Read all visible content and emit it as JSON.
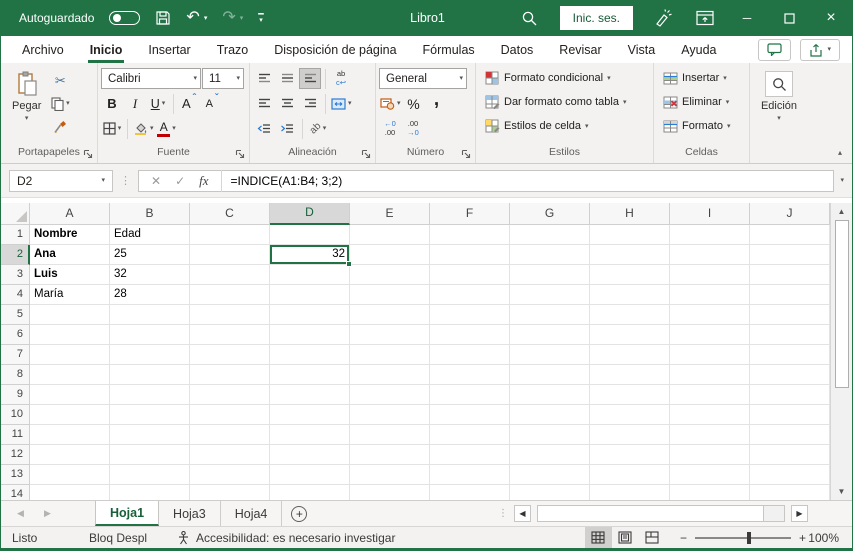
{
  "window": {
    "autosave_label": "Autoguardado",
    "title": "Libro1",
    "signin_label": "Inic. ses."
  },
  "tabs": {
    "active": "Inicio",
    "items": [
      {
        "label": "Archivo"
      },
      {
        "label": "Inicio"
      },
      {
        "label": "Insertar"
      },
      {
        "label": "Trazo"
      },
      {
        "label": "Disposición de página"
      },
      {
        "label": "Fórmulas"
      },
      {
        "label": "Datos"
      },
      {
        "label": "Revisar"
      },
      {
        "label": "Vista"
      },
      {
        "label": "Ayuda"
      }
    ]
  },
  "ribbon": {
    "paste_label": "Pegar",
    "clipboard_group": "Portapapeles",
    "font_group": "Fuente",
    "font_name": "Calibri",
    "font_size": "11",
    "alignment_group": "Alineación",
    "number_group": "Número",
    "number_format": "General",
    "styles_group": "Estilos",
    "styles_buttons": [
      "Formato condicional",
      "Dar formato como tabla",
      "Estilos de celda"
    ],
    "cells_group": "Celdas",
    "cells_buttons": [
      "Insertar",
      "Eliminar",
      "Formato"
    ],
    "editing_group": "Edición"
  },
  "formula_bar": {
    "name_box": "D2",
    "fx_label": "fx",
    "formula": "=INDICE(A1:B4; 3;2)"
  },
  "grid": {
    "columns": [
      "A",
      "B",
      "C",
      "D",
      "E",
      "F",
      "G",
      "H",
      "I",
      "J"
    ],
    "row_count": 14,
    "selected_cell": "D2",
    "selected_column": "D",
    "selected_row": 2,
    "cells": [
      {
        "ref": "A1",
        "value": "Nombre",
        "bold": true
      },
      {
        "ref": "B1",
        "value": "Edad",
        "bold": false
      },
      {
        "ref": "A2",
        "value": "Ana",
        "bold": true
      },
      {
        "ref": "B2",
        "value": "25",
        "bold": false
      },
      {
        "ref": "A3",
        "value": "Luis",
        "bold": true
      },
      {
        "ref": "B3",
        "value": "32",
        "bold": false
      },
      {
        "ref": "A4",
        "value": "María",
        "bold": false
      },
      {
        "ref": "B4",
        "value": "28",
        "bold": false
      },
      {
        "ref": "D2",
        "value": "32",
        "bold": false,
        "align": "right",
        "selected": true
      }
    ]
  },
  "sheet_bar": {
    "active": "Hoja1",
    "tabs": [
      {
        "label": "Hoja1"
      },
      {
        "label": "Hoja3"
      },
      {
        "label": "Hoja4"
      }
    ]
  },
  "status_bar": {
    "mode": "Listo",
    "scroll_lock": "Bloq Despl",
    "accessibility": "Accesibilidad: es necesario investigar",
    "zoom_level": "100%"
  },
  "icons": {
    "chevron_down": "▾",
    "chevron_up": "▴",
    "undo": "↶",
    "redo": "↷",
    "scissors": "✂",
    "bold": "B",
    "italic": "I",
    "underline": "U",
    "letter_a": "A",
    "caret_up": "ˆ",
    "caret_down": "ˇ",
    "percent": "%",
    "comma": ",",
    "wrap_top": "ab",
    "wrap_bottom": "c↩",
    "orientation": "ab",
    "inc_dec_top": "←0",
    "inc_dec_bottom": ".00",
    "dec_dec_top": ".00",
    "dec_dec_bottom": "→0",
    "minimize": "─",
    "close": "×",
    "dots_vertical": "⋮",
    "arrow_up": "▲",
    "arrow_down": "▼",
    "arrow_left": "◀",
    "arrow_right": "▶",
    "plus": "+",
    "minus": "−",
    "cancel": "✕",
    "enter_check": "✓"
  },
  "colors": {
    "brand_green": "#217346",
    "selection_green": "#217346",
    "font_color_red": "#c00000"
  }
}
